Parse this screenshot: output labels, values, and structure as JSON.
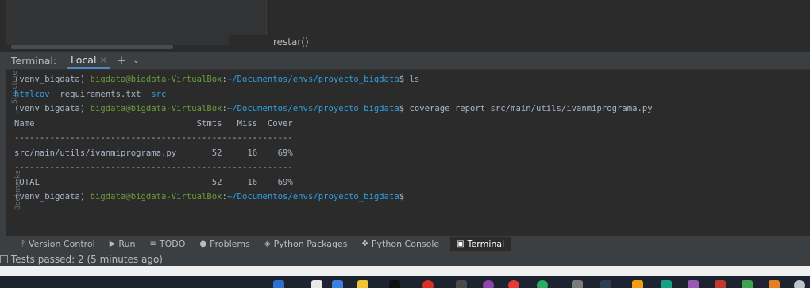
{
  "editor": {
    "breadcrumb": "restar()"
  },
  "side_labels": {
    "structure": "Structure",
    "bookmarks": "Bookmarks"
  },
  "terminal": {
    "title": "Terminal:",
    "tab_label": "Local",
    "tab_close": "×",
    "new_tab": "+",
    "dropdown": "⌄",
    "lines": {
      "l1_venv": "(venv_bigdata) ",
      "l1_user": "bigdata@bigdata-VirtualBox",
      "l1_colon": ":",
      "l1_path": "~/Documentos/envs/proyecto_bigdata",
      "l1_cmd": "$ ls",
      "l2_dir1": "htmlcov",
      "l2_file": "  requirements.txt  ",
      "l2_dir2": "src",
      "l3_venv": "(venv_bigdata) ",
      "l3_user": "bigdata@bigdata-VirtualBox",
      "l3_colon": ":",
      "l3_path": "~/Documentos/envs/proyecto_bigdata",
      "l3_cmd": "$ coverage report src/main/utils/ivanmiprograma.py",
      "l4": "Name                                Stmts   Miss  Cover",
      "l5": "-------------------------------------------------------",
      "l6": "src/main/utils/ivanmiprograma.py       52     16    69%",
      "l7": "-------------------------------------------------------",
      "l8": "TOTAL                                  52     16    69%",
      "l9_venv": "(venv_bigdata) ",
      "l9_user": "bigdata@bigdata-VirtualBox",
      "l9_colon": ":",
      "l9_path": "~/Documentos/envs/proyecto_bigdata",
      "l9_cmd": "$"
    }
  },
  "bottom_tabs": [
    {
      "icon": "ᚹ",
      "label": "Version Control"
    },
    {
      "icon": "▶",
      "label": "Run"
    },
    {
      "icon": "≡",
      "label": "TODO"
    },
    {
      "icon": "●",
      "label": "Problems"
    },
    {
      "icon": "◈",
      "label": "Python Packages"
    },
    {
      "icon": "✥",
      "label": "Python Console"
    },
    {
      "icon": "▣",
      "label": "Terminal"
    }
  ],
  "status": {
    "text": "Tests passed: 2 (5 minutes ago)"
  },
  "colors": {
    "accent": "#4a88c7",
    "prompt_user": "#6a9b3c",
    "prompt_path": "#2f9ee2"
  }
}
